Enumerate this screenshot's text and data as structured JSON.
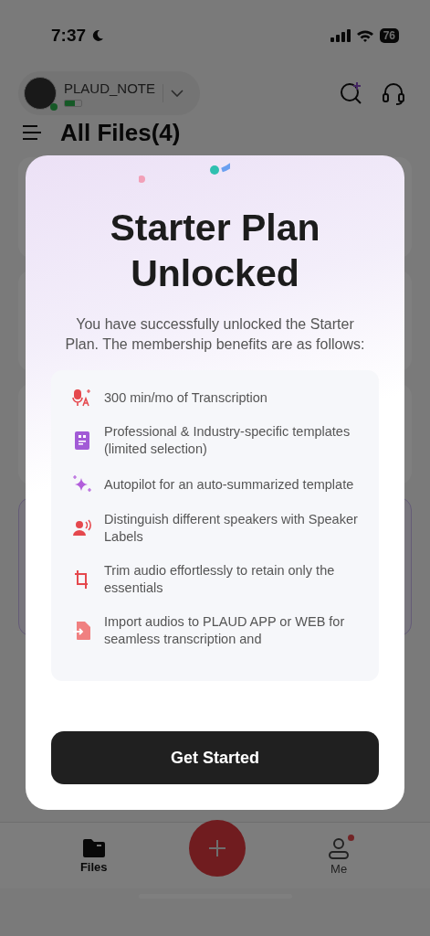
{
  "status_bar": {
    "time": "7:37",
    "battery": "76"
  },
  "device": {
    "name": "PLAUD_NOTE",
    "connected": true,
    "level": 0.6
  },
  "heading": "All Files(4)",
  "modal": {
    "title": "Starter Plan Unlocked",
    "subtitle": "You have successfully unlocked the Starter Plan. The membership benefits are as follows:",
    "benefits": [
      {
        "kind": "transcription",
        "text": "300 min/mo of Transcription"
      },
      {
        "kind": "template",
        "text": "Professional & Industry-specific templates (limited selection)"
      },
      {
        "kind": "autopilot",
        "text": "Autopilot for an auto-summarized template"
      },
      {
        "kind": "speakers",
        "text": "Distinguish different speakers with Speaker Labels"
      },
      {
        "kind": "trim",
        "text": "Trim audio effortlessly to retain only the essentials"
      },
      {
        "kind": "import",
        "text": "Import audios to PLAUD APP or WEB for seamless transcription and"
      }
    ],
    "button": "Get Started"
  },
  "nav": [
    {
      "kind": "files",
      "label": "Files",
      "selected": true,
      "badge": false
    },
    {
      "kind": "record"
    },
    {
      "kind": "me",
      "label": "Me",
      "selected": false,
      "badge": true
    }
  ]
}
